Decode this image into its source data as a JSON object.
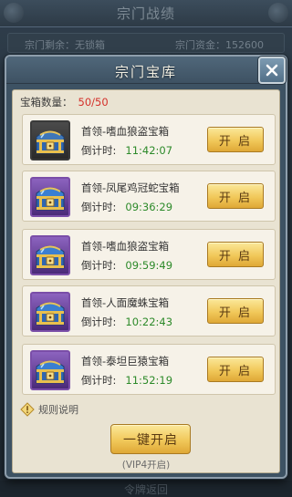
{
  "background": {
    "title": "宗门战绩",
    "info_left": "宗门剩余：无锁箱",
    "info_right": "宗门资金：152600",
    "footer": "令牌返回"
  },
  "dialog": {
    "title": "宗门宝库",
    "count_label": "宝箱数量：",
    "count_value": "50/50",
    "countdown_label": "倒计时:",
    "open_label": "开 启",
    "chests": [
      {
        "name": "首领-嗜血狼盗宝箱",
        "time": "11:42:07",
        "style": "dark"
      },
      {
        "name": "首领-凤尾鸡冠蛇宝箱",
        "time": "09:36:29",
        "style": "purple"
      },
      {
        "name": "首领-嗜血狼盗宝箱",
        "time": "09:59:49",
        "style": "purple"
      },
      {
        "name": "首领-人面魔蛛宝箱",
        "time": "10:22:43",
        "style": "purple"
      },
      {
        "name": "首领-泰坦巨猿宝箱",
        "time": "11:52:19",
        "style": "purple"
      }
    ],
    "rules_label": "规则说明",
    "one_key_label": "一键开启",
    "vip_note": "(VIP4开启)"
  },
  "icons": {
    "close": "close-icon",
    "chest": "treasure-chest-icon",
    "rules": "info-diamond-icon"
  },
  "colors": {
    "accent_gold": "#f1c85a",
    "count_red": "#d4302a",
    "timer_green": "#2d8a2a"
  }
}
